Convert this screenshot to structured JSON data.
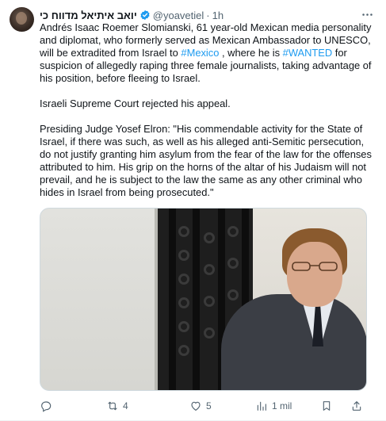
{
  "tweet": {
    "display_name": "יואב איתיאל מדווח כי",
    "handle": "@yoavetiel",
    "separator": "·",
    "time": "1h",
    "paragraph1_pre": "Andrés Isaac Roemer Slomianski, 61 year-old Mexican media personality and diplomat, who formerly served as Mexican Ambassador to UNESCO, will be extradited from Israel to ",
    "hashtag_mexico": "#Mexico",
    "paragraph1_mid": " , where he is ",
    "hashtag_wanted": "#WANTED",
    "paragraph1_post": "  for suspicion of allegedly raping three female journalists, taking advantage of his position, before fleeing to Israel.",
    "paragraph2": "Israeli Supreme Court rejected his appeal.",
    "paragraph3": "Presiding Judge Yosef Elron: \"His commendable activity for the State of Israel, if there was such, as well as his alleged anti-Semitic persecution, do not justify granting him asylum from the fear of the law for the offenses attributed to him. His grip on the horns of the altar of his Judaism will not prevail, and he is subject to the law the same as any other criminal who hides in Israel from being prosecuted.\""
  },
  "actions": {
    "reply_count": "",
    "retweet_count": "4",
    "like_count": "5",
    "views_count": "1 mil"
  },
  "colors": {
    "link": "#1d9bf0",
    "verified": "#1d9bf0",
    "muted": "#536471",
    "text": "#0f1419"
  },
  "icons": [
    "verified-badge-icon",
    "more-icon",
    "reply-icon",
    "retweet-icon",
    "like-icon",
    "views-icon",
    "bookmark-icon",
    "share-icon"
  ]
}
